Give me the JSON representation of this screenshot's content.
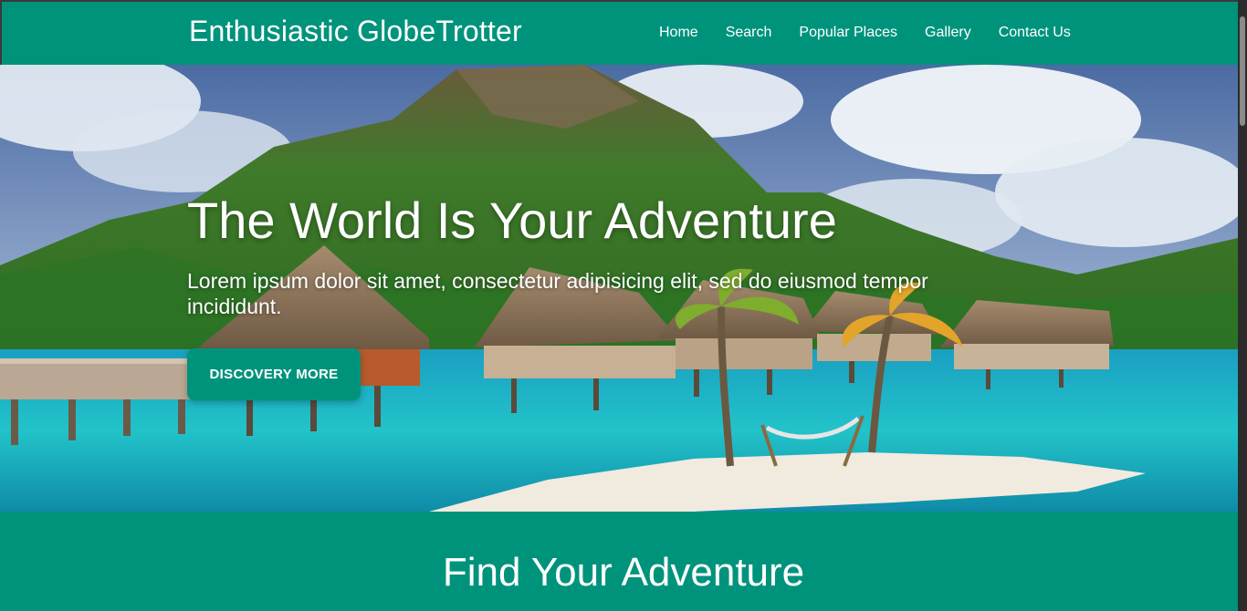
{
  "brand": "Enthusiastic GlobeTrotter",
  "nav": {
    "items": [
      {
        "label": "Home"
      },
      {
        "label": "Search"
      },
      {
        "label": "Popular Places"
      },
      {
        "label": "Gallery"
      },
      {
        "label": "Contact Us"
      }
    ]
  },
  "hero": {
    "title": "The World Is Your Adventure",
    "subtitle": "Lorem ipsum dolor sit amet, consectetur adipisicing elit, sed do eiusmod tempor incididunt.",
    "cta_label": "DISCOVERY MORE"
  },
  "section": {
    "title": "Find Your Adventure"
  },
  "colors": {
    "accent": "#00937c",
    "text": "#ffffff"
  }
}
